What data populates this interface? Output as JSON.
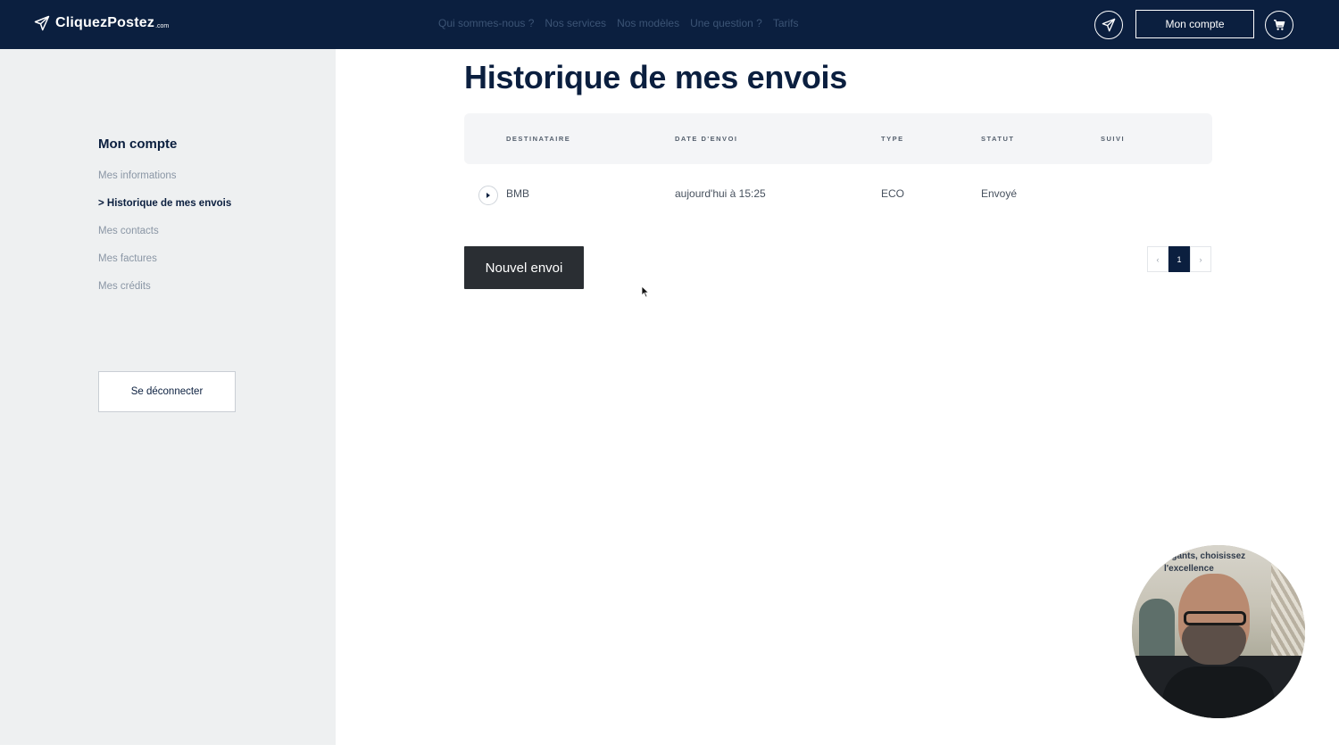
{
  "header": {
    "logo_text": "CliquezPostez",
    "logo_suffix": ".com",
    "nav": [
      "Qui sommes-nous ?",
      "Nos services",
      "Nos modèles",
      "Une question ?",
      "Tarifs"
    ],
    "account_label": "Mon compte"
  },
  "sidebar": {
    "title": "Mon compte",
    "items": [
      {
        "label": "Mes informations",
        "active": false
      },
      {
        "label": "> Historique de mes envois",
        "active": true
      },
      {
        "label": "Mes contacts",
        "active": false
      },
      {
        "label": "Mes factures",
        "active": false
      },
      {
        "label": "Mes crédits",
        "active": false
      }
    ],
    "logout_label": "Se déconnecter"
  },
  "main": {
    "title": "Historique de mes envois",
    "table": {
      "columns": [
        "DESTINATAIRE",
        "DATE D'ENVOI",
        "TYPE",
        "STATUT",
        "SUIVI"
      ],
      "rows": [
        {
          "destinataire": "BMB",
          "date": "aujourd'hui à 15:25",
          "type": "ECO",
          "statut": "Envoyé",
          "suivi": ""
        }
      ]
    },
    "new_button_label": "Nouvel envoi",
    "pagination": {
      "prev": "‹",
      "current": "1",
      "next": "›"
    }
  },
  "webcam": {
    "overlay_text_lines": [
      "...gants, choisissez",
      "l'excellence"
    ]
  },
  "colors": {
    "navy": "#0b1f3f",
    "sidebar_bg": "#eef0f1",
    "button_dark": "#2a2e33"
  },
  "icons": {
    "logo": "paper-plane-icon",
    "send": "paper-plane-icon",
    "cart": "cart-icon",
    "expand": "chevron-right-icon"
  }
}
